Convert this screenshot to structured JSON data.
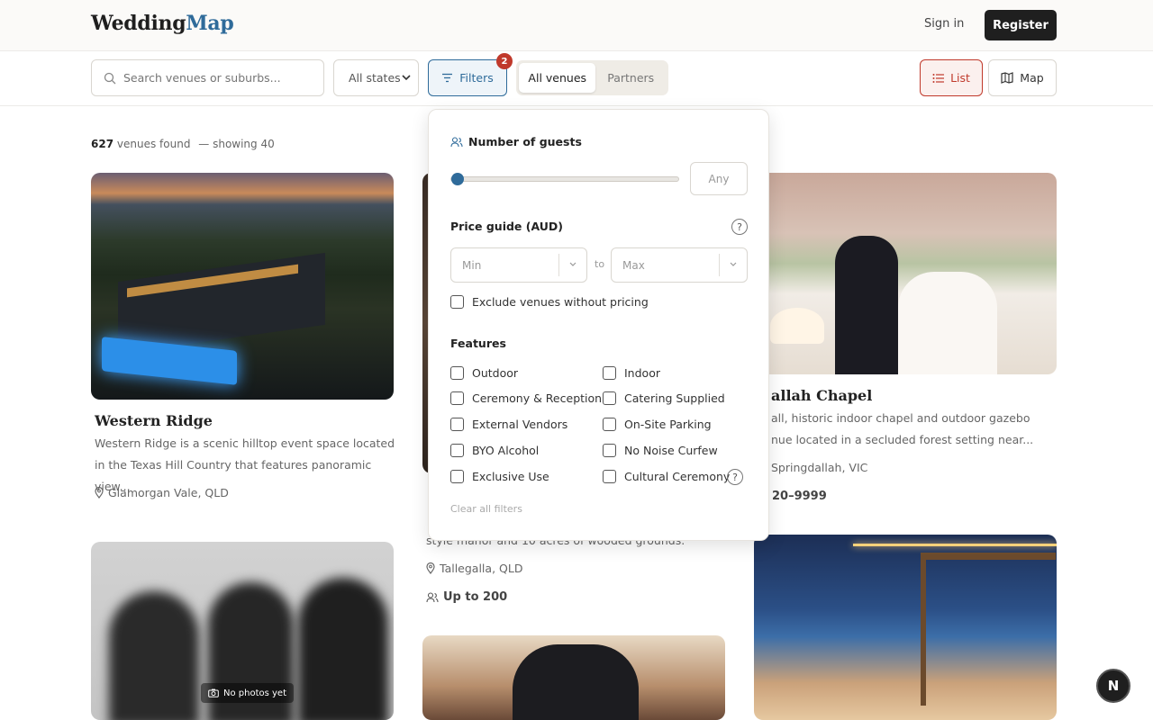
{
  "header": {
    "logo_part1": "Wedding",
    "logo_part2": "Map",
    "sign_in": "Sign in",
    "register": "Register"
  },
  "toolbar": {
    "search_placeholder": "Search venues or suburbs...",
    "state_select": "All states",
    "filters_label": "Filters",
    "filters_badge": "2",
    "segment_all": "All venues",
    "segment_partners": "Partners",
    "list_label": "List",
    "map_label": "Map"
  },
  "results": {
    "count": "627",
    "count_label": "venues found",
    "showing": "— showing 40"
  },
  "cards": [
    {
      "title": "Western Ridge",
      "desc1": "Western Ridge is a scenic hilltop event space located",
      "desc2": "in the Texas Hill Country that features panoramic view...",
      "location": "Glamorgan Vale, QLD"
    },
    {
      "desc_tail": "style manor and 10 acres of wooded grounds.",
      "location": "Tallegalla, QLD",
      "capacity": "Up to 200"
    },
    {
      "title": "allah Chapel",
      "desc1": "all, historic indoor chapel and outdoor gazebo",
      "desc2": "nue located in a secluded forest setting near...",
      "location": "Springdallah, VIC",
      "capacity": "20–9999"
    },
    {
      "no_photo": "No photos yet"
    }
  ],
  "filter_panel": {
    "guests_title": "Number of guests",
    "guests_value": "Any",
    "price_title": "Price guide (AUD)",
    "min_placeholder": "Min",
    "to_label": "to",
    "max_placeholder": "Max",
    "exclude_label": "Exclude venues without pricing",
    "features_title": "Features",
    "features": [
      {
        "label": "Outdoor"
      },
      {
        "label": "Indoor"
      },
      {
        "label": "Ceremony & Reception"
      },
      {
        "label": "Catering Supplied"
      },
      {
        "label": "External Vendors"
      },
      {
        "label": "On-Site Parking"
      },
      {
        "label": "BYO Alcohol"
      },
      {
        "label": "No Noise Curfew"
      },
      {
        "label": "Exclusive Use"
      },
      {
        "label": "Cultural Ceremony"
      }
    ],
    "help_glyph": "?",
    "clear_all": "Clear all filters"
  },
  "fab_label": "N",
  "colors": {
    "accent_blue": "#2f6b9a",
    "accent_red": "#c0392b",
    "dark": "#1f1f1f"
  }
}
